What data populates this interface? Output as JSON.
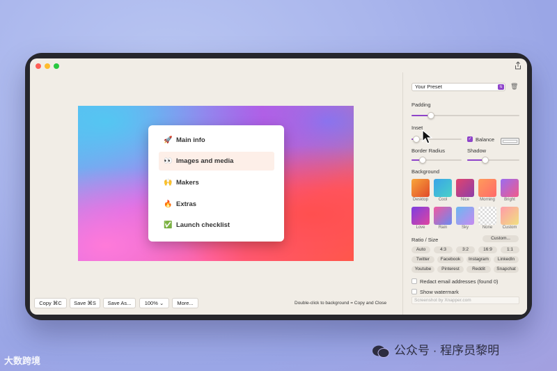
{
  "window": {
    "share_icon": "share-icon"
  },
  "sidebar": {
    "preset": "Your Preset",
    "padding_label": "Padding",
    "inset_label": "Inset",
    "balance_label": "Balance",
    "border_radius_label": "Border Radius",
    "shadow_label": "Shadow",
    "background_label": "Background",
    "backgrounds": [
      {
        "name": "Desktop",
        "colors": [
          "#f9a63a",
          "#e0492a"
        ]
      },
      {
        "name": "Cool",
        "colors": [
          "#3aa4e8",
          "#48d0c8"
        ]
      },
      {
        "name": "Nice",
        "colors": [
          "#e0446e",
          "#8e3ea8"
        ]
      },
      {
        "name": "Morning",
        "colors": [
          "#ff9a5a",
          "#ff6a6a"
        ]
      },
      {
        "name": "Bright",
        "colors": [
          "#9b6cf0",
          "#f05a8a"
        ]
      },
      {
        "name": "Love",
        "colors": [
          "#7b3fe0",
          "#e045a0"
        ]
      },
      {
        "name": "Rain",
        "colors": [
          "#f05aa0",
          "#6a8af0"
        ]
      },
      {
        "name": "Sky",
        "colors": [
          "#6ab8f0",
          "#c88af0"
        ]
      },
      {
        "name": "None",
        "colors": [
          "#dddddd",
          "#bbbbbb"
        ]
      },
      {
        "name": "Custom",
        "colors": [
          "#ff9aa8",
          "#f0e080"
        ]
      }
    ],
    "ratio_label": "Ratio / Size",
    "custom_label": "Custom...",
    "ratios": [
      "Auto",
      "4:3",
      "3:2",
      "16:9",
      "1:1"
    ],
    "platforms_row1": [
      "Twitter",
      "Facebook",
      "Instagram",
      "LinkedIn"
    ],
    "platforms_row2": [
      "Youtube",
      "Pinterest",
      "Reddit",
      "Snapchat"
    ],
    "redact_label": "Redact email addresses (found 0)",
    "watermark_label": "Show watermark",
    "watermark_placeholder": "Screenshot by Xnapper.com",
    "padding_value": 0.18,
    "inset_value": 0.05,
    "border_radius_value": 0.22,
    "shadow_value": 0.35,
    "balance_checked": true
  },
  "canvas": {
    "menu": [
      {
        "emoji": "🚀",
        "label": "Main info",
        "active": false
      },
      {
        "emoji": "👀",
        "label": "Images and media",
        "active": true
      },
      {
        "emoji": "🙌",
        "label": "Makers",
        "active": false
      },
      {
        "emoji": "🔥",
        "label": "Extras",
        "active": false
      },
      {
        "emoji": "✅",
        "label": "Launch checklist",
        "active": false
      }
    ]
  },
  "toolbar": {
    "copy": "Copy ⌘C",
    "save": "Save ⌘S",
    "save_as": "Save As...",
    "zoom": "100%",
    "more": "More...",
    "hint": "Double-click to background = Copy and Close"
  },
  "watermarks": {
    "left": "大数跨境",
    "right": "公众号 · 程序员黎明"
  },
  "colors": {
    "accent": "#8e43c9"
  }
}
